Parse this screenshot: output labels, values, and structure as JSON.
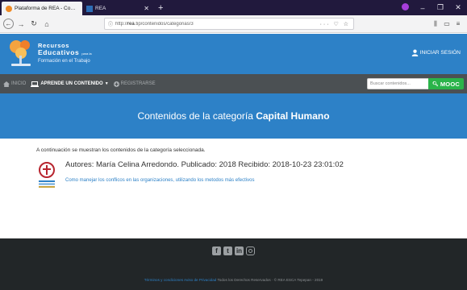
{
  "browser": {
    "tabs": [
      {
        "title": "Plataforma de REA - Contenido X",
        "active": true
      },
      {
        "title": "REA",
        "active": false
      }
    ],
    "url_prefix": "http://",
    "url_host": "rea",
    "url_path": ".tip/contenidos/categorias/3",
    "url_actions": "··· ♡ ☆"
  },
  "site": {
    "logo": {
      "line1": "Recursos",
      "line2": "Educativos",
      "line2_small": "para la",
      "line3": "Formación",
      "line3_mid": "en el",
      "line3_end": "Trabajo"
    },
    "login_label": "INICIAR SESIÓN",
    "nav": {
      "inicio": "INICIO",
      "aprende": "APRENDE UN CONTENIDO",
      "registrarse": "REGISTRARSE"
    },
    "search_placeholder": "Buscar contenidos...",
    "mooc_label": "MOOC"
  },
  "hero": {
    "prefix": "Contenidos de la categoría ",
    "category": "Capital Humano"
  },
  "content": {
    "intro": "A continuación se muestran los contenidos de la categoría seleccionada.",
    "items": [
      {
        "authors": "Autores: María Celina Arredondo. Publicado: 2018 Recibido: 2018-10-23 23:01:02",
        "link": "Como manejar los conflicos en las organizaciones, utilizando los metodos más efectivos"
      }
    ]
  },
  "footer": {
    "terms": "Términos y condiciones",
    "privacy": "Aviso de Privacidad",
    "rights": "Todos los Derechos Reservados · © REA ESCA Tepepan - 2019"
  },
  "colors": {
    "brand_blue": "#2d81c7",
    "nav_gray": "#4b5053",
    "mooc_green": "#2ab44a",
    "footer_dark": "#222628"
  }
}
